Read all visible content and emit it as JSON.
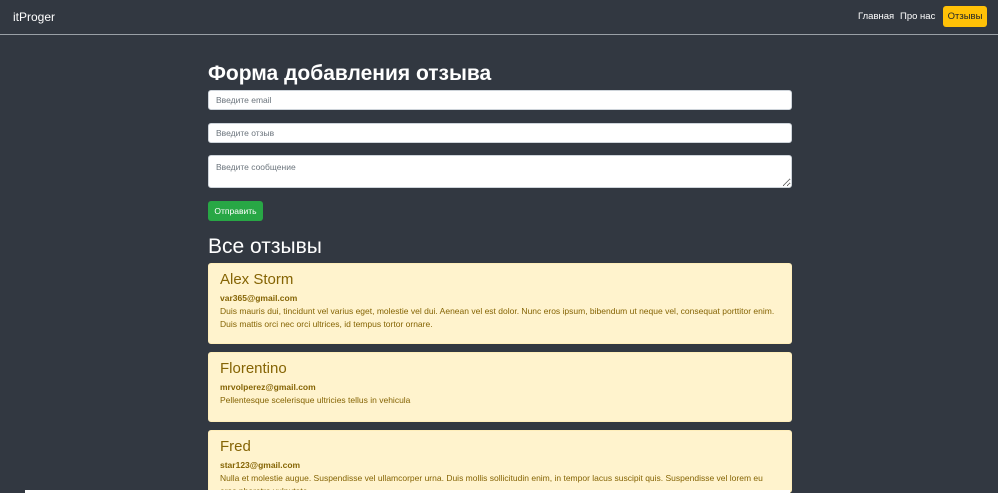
{
  "nav": {
    "brand": "itProger",
    "links": [
      {
        "label": "Главная"
      },
      {
        "label": "Про нас"
      }
    ],
    "active": "Отзывы"
  },
  "form": {
    "title": "Форма добавления отзыва",
    "email_placeholder": "Введите email",
    "review_placeholder": "Введите отзыв",
    "message_placeholder": "Введите сообщение",
    "submit_label": "Отправить"
  },
  "reviews": {
    "title": "Все отзывы",
    "items": [
      {
        "name": "Alex Storm",
        "email": "var365@gmail.com",
        "text": "Duis mauris dui, tincidunt vel varius eget, molestie vel dui. Aenean vel est dolor. Nunc eros ipsum, bibendum ut neque vel, consequat porttitor enim. Duis mattis orci nec orci ultrices, id tempus tortor ornare."
      },
      {
        "name": "Florentino",
        "email": "mrvolperez@gmail.com",
        "text": "Pellentesque scelerisque ultricies tellus in vehicula"
      },
      {
        "name": "Fred",
        "email": "star123@gmail.com",
        "text": "Nulla et molestie augue. Suspendisse vel ullamcorper urna. Duis mollis sollicitudin enim, in tempor lacus suscipit quis. Suspendisse vel lorem eu eros pharetra vulputate."
      }
    ]
  },
  "colors": {
    "background": "#323841",
    "accent": "#ffc107",
    "success": "#28a745",
    "card_bg": "#fff3cd",
    "card_text": "#856404"
  }
}
